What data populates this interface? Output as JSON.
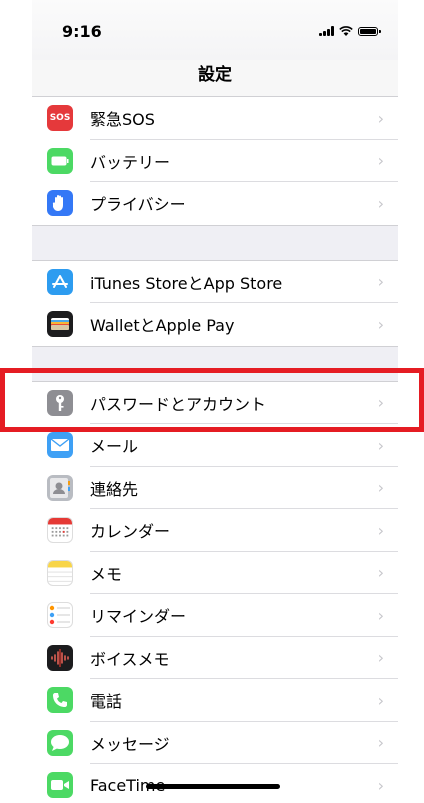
{
  "status_bar": {
    "time": "9:16"
  },
  "nav": {
    "title": "設定"
  },
  "groups": [
    [
      {
        "label": "緊急SOS",
        "icon": "sos-icon",
        "icon_text": "SOS",
        "icon_color": "#e5393b"
      },
      {
        "label": "バッテリー",
        "icon": "battery-icon",
        "icon_color": "#4cd964"
      },
      {
        "label": "プライバシー",
        "icon": "hand-icon",
        "icon_color": "#3478f6"
      }
    ],
    [
      {
        "label": "iTunes StoreとApp Store",
        "icon": "app-store-icon",
        "icon_color": "#2d9cf0"
      },
      {
        "label": "WalletとApple Pay",
        "icon": "wallet-icon",
        "icon_color": "#1c1c1e"
      }
    ],
    [
      {
        "label": "パスワードとアカウント",
        "icon": "key-icon",
        "icon_color": "#8e8e93"
      },
      {
        "label": "メール",
        "icon": "mail-icon",
        "icon_color": "#3ea0f5"
      },
      {
        "label": "連絡先",
        "icon": "contacts-icon",
        "icon_color": "#b9bcc2"
      },
      {
        "label": "カレンダー",
        "icon": "calendar-icon",
        "icon_color": "#ffffff"
      },
      {
        "label": "メモ",
        "icon": "notes-icon",
        "icon_color": "#ffffff"
      },
      {
        "label": "リマインダー",
        "icon": "reminders-icon",
        "icon_color": "#ffffff"
      },
      {
        "label": "ボイスメモ",
        "icon": "voice-memo-icon",
        "icon_color": "#1c1c1e"
      },
      {
        "label": "電話",
        "icon": "phone-icon",
        "icon_color": "#4cd964"
      },
      {
        "label": "メッセージ",
        "icon": "messages-icon",
        "icon_color": "#4cd964"
      },
      {
        "label": "FaceTime",
        "icon": "facetime-icon",
        "icon_color": "#4cd964"
      }
    ]
  ],
  "chevron": "›",
  "highlight_color": "#e51c23"
}
